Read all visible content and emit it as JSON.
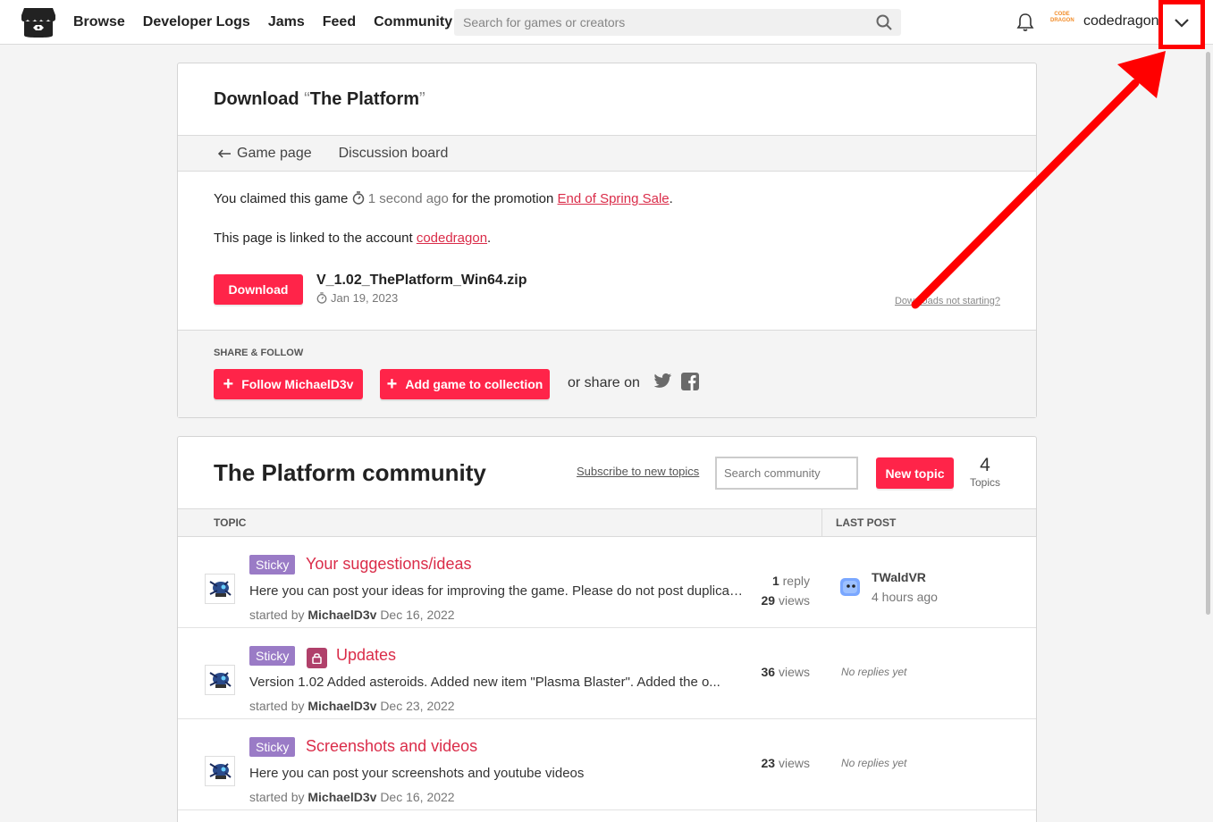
{
  "nav": {
    "links": [
      "Browse",
      "Developer Logs",
      "Jams",
      "Feed",
      "Community"
    ],
    "search_placeholder": "Search for games or creators",
    "avatar_text": "CODE DRAGON",
    "username": "codedragon",
    "icons": {
      "logo": "itchio-logo-icon",
      "search": "search-icon",
      "bell": "bell-icon",
      "dropdown": "chevron-down-icon"
    }
  },
  "download": {
    "title_prefix": "Download ",
    "title_open_quote": "“",
    "title_name": "The Platform",
    "title_close_quote": "”",
    "subnav": {
      "game_page": "Game page",
      "discussion": "Discussion board"
    },
    "claim": {
      "prefix": "You claimed this game",
      "time": "1 second ago",
      "middle": "for the promotion",
      "promo": "End of Spring Sale",
      "end": "."
    },
    "linked": {
      "prefix": "This page is linked to the account",
      "account": "codedragon",
      "end": "."
    },
    "button": "Download",
    "file_name": "V_1.02_ThePlatform_Win64.zip",
    "file_date": "Jan 19, 2023",
    "help_link": "Downloads not starting?"
  },
  "share": {
    "title": "SHARE & FOLLOW",
    "follow": "Follow MichaelD3v",
    "collection": "Add game to collection",
    "share_on": "or share on",
    "icons": [
      "twitter-icon",
      "facebook-icon"
    ]
  },
  "community": {
    "title": "The Platform community",
    "subscribe": "Subscribe to new topics",
    "search_placeholder": "Search community",
    "new_topic": "New topic",
    "topic_count": "4",
    "topic_count_label": "Topics",
    "col_topic": "TOPIC",
    "col_last_post": "LAST POST",
    "topics": [
      {
        "badge": "Sticky",
        "title": "Your suggestions/ideas",
        "excerpt": "Here you can post your ideas for improving the game. Please do not post duplicates.",
        "started_by": "started by",
        "author": "MichaelD3v",
        "date": "Dec 16, 2022",
        "replies": "1",
        "replies_label": "reply",
        "views": "29",
        "views_label": "views",
        "last_user": "TWaldVR",
        "last_time": "4 hours ago"
      },
      {
        "badge": "Sticky",
        "title": "Updates",
        "excerpt": "Version 1.02 Added asteroids. Added new item \"Plasma Blaster\". Added the o...",
        "started_by": "started by",
        "author": "MichaelD3v",
        "date": "Dec 23, 2022",
        "views": "36",
        "views_label": "views",
        "no_replies": "No replies yet",
        "locked": true
      },
      {
        "badge": "Sticky",
        "title": "Screenshots and videos",
        "excerpt": "Here you can post your screenshots and youtube videos",
        "started_by": "started by",
        "author": "MichaelD3v",
        "date": "Dec 16, 2022",
        "views": "23",
        "views_label": "views",
        "no_replies": "No replies yet"
      }
    ]
  },
  "colors": {
    "accent": "#ff2449",
    "link": "#da2c49",
    "sticky": "#9a7bc6",
    "lock": "#b0406a",
    "annotation": "#ff0000"
  }
}
